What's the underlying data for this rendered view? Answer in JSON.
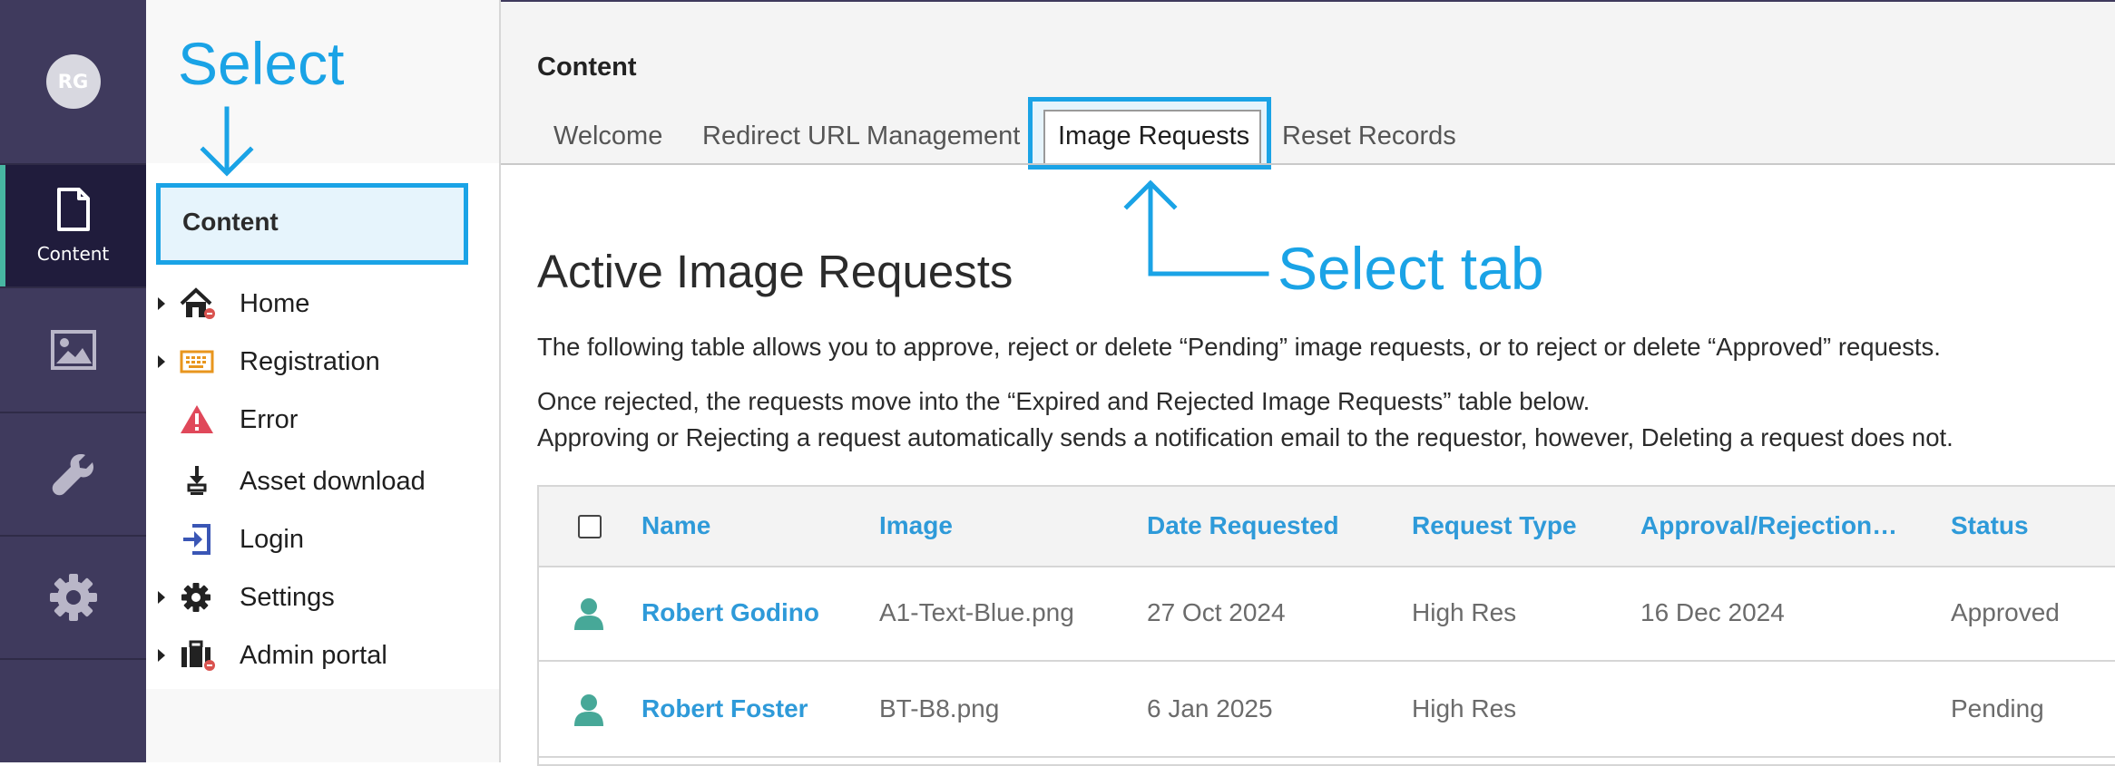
{
  "user": {
    "initials": "RG"
  },
  "rail": {
    "items": [
      {
        "label": "Content",
        "icon": "document-icon"
      },
      {
        "label": "",
        "icon": "image-icon"
      },
      {
        "label": "",
        "icon": "wrench-icon"
      },
      {
        "label": "",
        "icon": "gear-icon"
      }
    ]
  },
  "tree": {
    "section_title": "Content",
    "items": [
      {
        "label": "Home",
        "icon": "home-icon",
        "expandable": true
      },
      {
        "label": "Registration",
        "icon": "keyboard-icon",
        "expandable": true
      },
      {
        "label": "Error",
        "icon": "warning-icon",
        "expandable": false
      },
      {
        "label": "Asset download",
        "icon": "download-icon",
        "expandable": false
      },
      {
        "label": "Login",
        "icon": "login-icon",
        "expandable": false
      },
      {
        "label": "Settings",
        "icon": "gear-icon",
        "expandable": true
      },
      {
        "label": "Admin portal",
        "icon": "briefcase-icon",
        "expandable": true
      }
    ]
  },
  "main": {
    "title": "Content",
    "tabs": [
      {
        "label": "Welcome"
      },
      {
        "label": "Redirect URL Management"
      },
      {
        "label": "Image Requests",
        "active": true
      },
      {
        "label": "Reset Records"
      }
    ],
    "heading": "Active Image Requests",
    "description": [
      "The following table allows you to approve, reject or delete “Pending” image requests, or to reject or delete “Approved” requests.",
      "Once rejected, the requests move into the “Expired and Rejected Image Requests” table below.",
      "Approving or Rejecting a request automatically sends a notification email to the requestor, however, Deleting a request does not."
    ],
    "table": {
      "columns": [
        "Name",
        "Image",
        "Date Requested",
        "Request Type",
        "Approval/Rejection…",
        "Status"
      ],
      "rows": [
        {
          "name": "Robert Godino",
          "image": "A1-Text-Blue.png",
          "date_requested": "27 Oct 2024",
          "request_type": "High Res",
          "approval_date": "16 Dec 2024",
          "status": "Approved"
        },
        {
          "name": "Robert Foster",
          "image": "BT-B8.png",
          "date_requested": "6 Jan 2025",
          "request_type": "High Res",
          "approval_date": "",
          "status": "Pending"
        }
      ]
    }
  },
  "annotations": {
    "select": "Select",
    "select_tab": "Select tab"
  },
  "colors": {
    "rail_bg": "#3f3a5d",
    "rail_active_bg": "#201c3c",
    "rail_active_indicator": "#47b6a2",
    "annotation": "#1aa3e6",
    "link": "#2e9ad9",
    "user_icon": "#47a898"
  }
}
